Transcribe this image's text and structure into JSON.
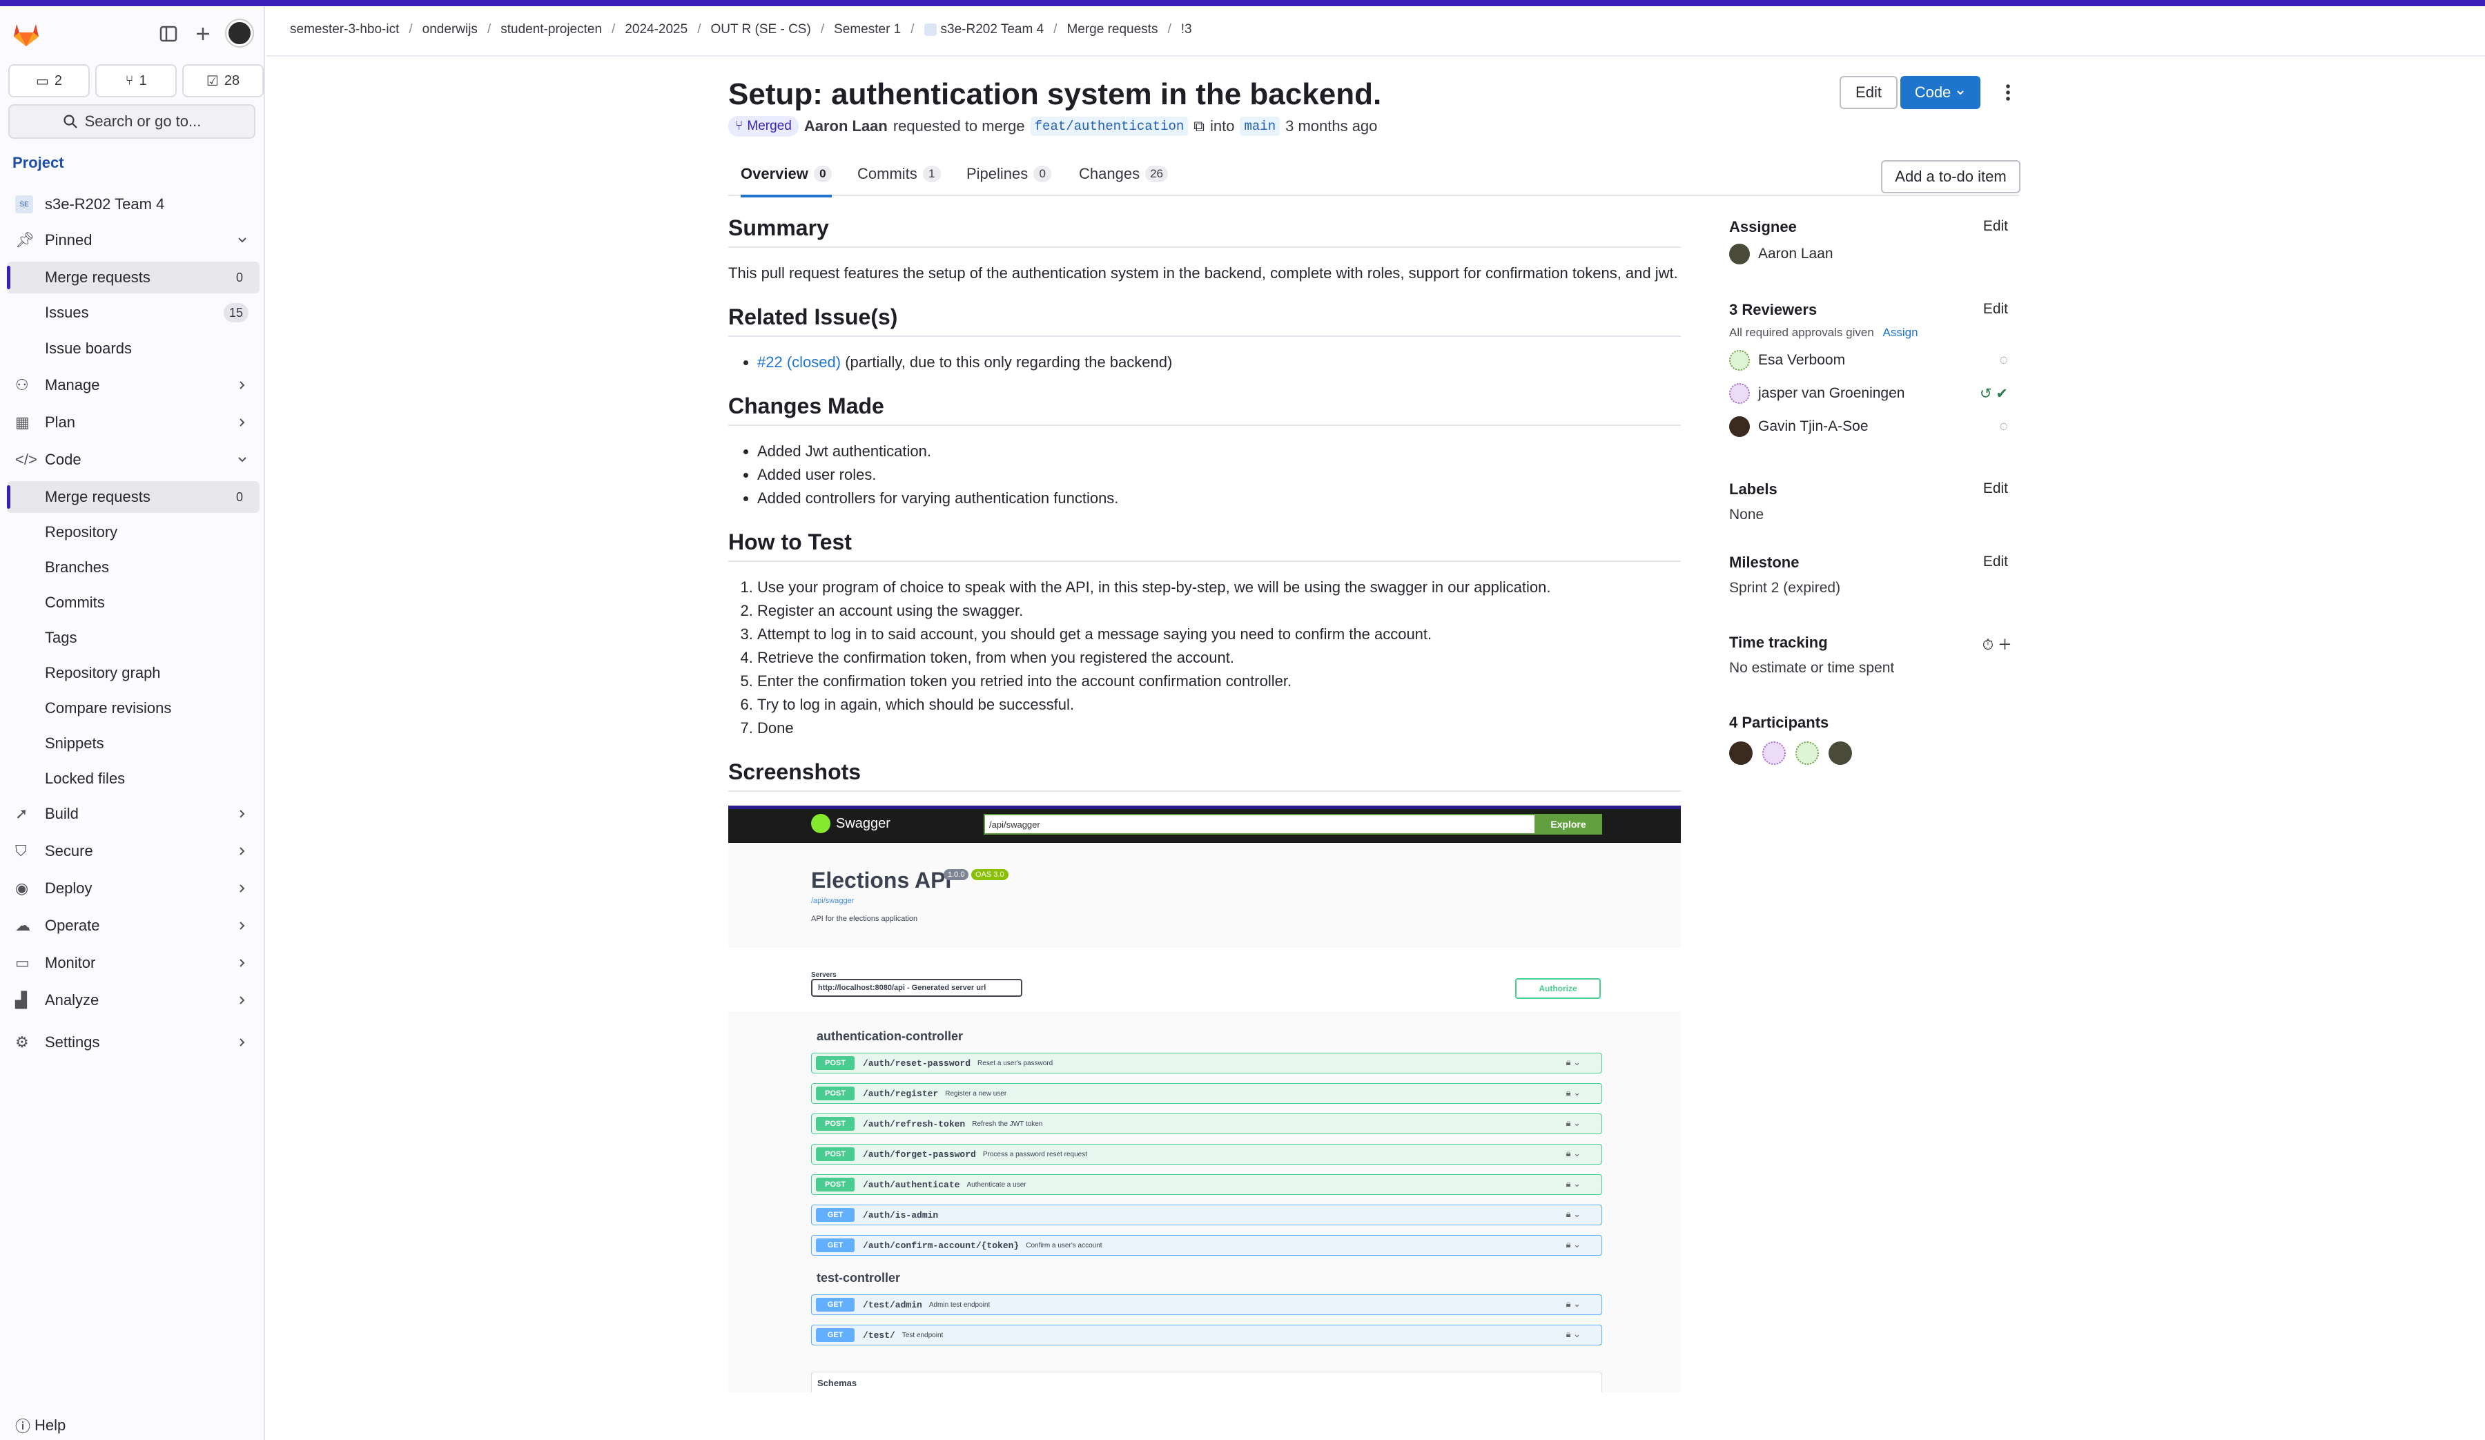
{
  "brand_color": "#3a1fb6",
  "accent_color": "#1f75cb",
  "sidebar": {
    "counts": {
      "issues": "2",
      "merge_requests": "1",
      "todos": "28"
    },
    "search_label": "Search or go to...",
    "project_heading": "Project",
    "project_name": "s3e-R202 Team 4",
    "pinned_label": "Pinned",
    "pinned_items": [
      {
        "label": "Merge requests",
        "badge": "0"
      },
      {
        "label": "Issues",
        "badge": "15"
      },
      {
        "label": "Issue boards",
        "badge": ""
      }
    ],
    "groups": [
      "Manage",
      "Plan",
      "Code"
    ],
    "code_items": [
      {
        "label": "Merge requests",
        "badge": "0"
      },
      {
        "label": "Repository"
      },
      {
        "label": "Branches"
      },
      {
        "label": "Commits"
      },
      {
        "label": "Tags"
      },
      {
        "label": "Repository graph"
      },
      {
        "label": "Compare revisions"
      },
      {
        "label": "Snippets"
      },
      {
        "label": "Locked files"
      }
    ],
    "bottom_groups": [
      "Build",
      "Secure",
      "Deploy",
      "Operate",
      "Monitor",
      "Analyze",
      "Settings"
    ],
    "help_label": "Help"
  },
  "breadcrumb": [
    "semester-3-hbo-ict",
    "onderwijs",
    "student-projecten",
    "2024-2025",
    "OUT R (SE - CS)",
    "Semester 1",
    "s3e-R202 Team 4",
    "Merge requests",
    "!3"
  ],
  "mr": {
    "title": "Setup: authentication system in the backend.",
    "status": "Merged",
    "author": "Aaron Laan",
    "requested_text": "requested to merge",
    "source_branch": "feat/authentication",
    "into_text": "into",
    "target_branch": "main",
    "time": "3 months ago",
    "edit_label": "Edit",
    "code_label": "Code",
    "todo_label": "Add a to-do item"
  },
  "tabs": [
    {
      "label": "Overview",
      "count": "0"
    },
    {
      "label": "Commits",
      "count": "1"
    },
    {
      "label": "Pipelines",
      "count": "0"
    },
    {
      "label": "Changes",
      "count": "26"
    }
  ],
  "description": {
    "summary_h": "Summary",
    "summary_p": "This pull request features the setup of the authentication system in the backend, complete with roles, support for confirmation tokens, and jwt.",
    "related_h": "Related Issue(s)",
    "related_link": "#22 (closed)",
    "related_rest": "(partially, due to this only regarding the backend)",
    "changes_h": "Changes Made",
    "changes": [
      "Added Jwt authentication.",
      "Added user roles.",
      "Added controllers for varying authentication functions."
    ],
    "howto_h": "How to Test",
    "steps": [
      "Use your program of choice to speak with the API, in this step-by-step, we will be using the swagger in our application.",
      "Register an account using the swagger.",
      "Attempt to log in to said account, you should get a message saying you need to confirm the account.",
      "Retrieve the confirmation token, from when you registered the account.",
      "Enter the confirmation token you retried into the account confirmation controller.",
      "Try to log in again, which should be successful.",
      "Done"
    ],
    "screens_h": "Screenshots"
  },
  "swagger": {
    "logo": "Swagger",
    "url": "/api/swagger",
    "explore": "Explore",
    "title": "Elections API",
    "version": "1.0.0",
    "oas": "OAS 3.0",
    "sub": "/api/swagger",
    "desc": "API for the elections application",
    "servers_label": "Servers",
    "server": "http://localhost:8080/api - Generated server url",
    "authorize": "Authorize",
    "sec1": "authentication-controller",
    "auth_rows": [
      {
        "m": "POST",
        "p": "/auth/reset-password",
        "d": "Reset a user's password"
      },
      {
        "m": "POST",
        "p": "/auth/register",
        "d": "Register a new user"
      },
      {
        "m": "POST",
        "p": "/auth/refresh-token",
        "d": "Refresh the JWT token"
      },
      {
        "m": "POST",
        "p": "/auth/forget-password",
        "d": "Process a password reset request"
      },
      {
        "m": "POST",
        "p": "/auth/authenticate",
        "d": "Authenticate a user"
      },
      {
        "m": "GET",
        "p": "/auth/is-admin",
        "d": ""
      },
      {
        "m": "GET",
        "p": "/auth/confirm-account/{token}",
        "d": "Confirm a user's account"
      }
    ],
    "sec2": "test-controller",
    "test_rows": [
      {
        "m": "GET",
        "p": "/test/admin",
        "d": "Admin test endpoint"
      },
      {
        "m": "GET",
        "p": "/test/",
        "d": "Test endpoint"
      }
    ],
    "schemas": "Schemas"
  },
  "sidebar_right": {
    "assignee_h": "Assignee",
    "assignee": "Aaron Laan",
    "edit": "Edit",
    "reviewers_h": "3 Reviewers",
    "approvals": "All required approvals given",
    "assign": "Assign",
    "reviewers": [
      "Esa Verboom",
      "jasper van Groeningen",
      "Gavin Tjin-A-Soe"
    ],
    "labels_h": "Labels",
    "labels": "None",
    "milestone_h": "Milestone",
    "milestone": "Sprint 2 (expired)",
    "time_h": "Time tracking",
    "time": "No estimate or time spent",
    "participants_h": "4 Participants"
  }
}
